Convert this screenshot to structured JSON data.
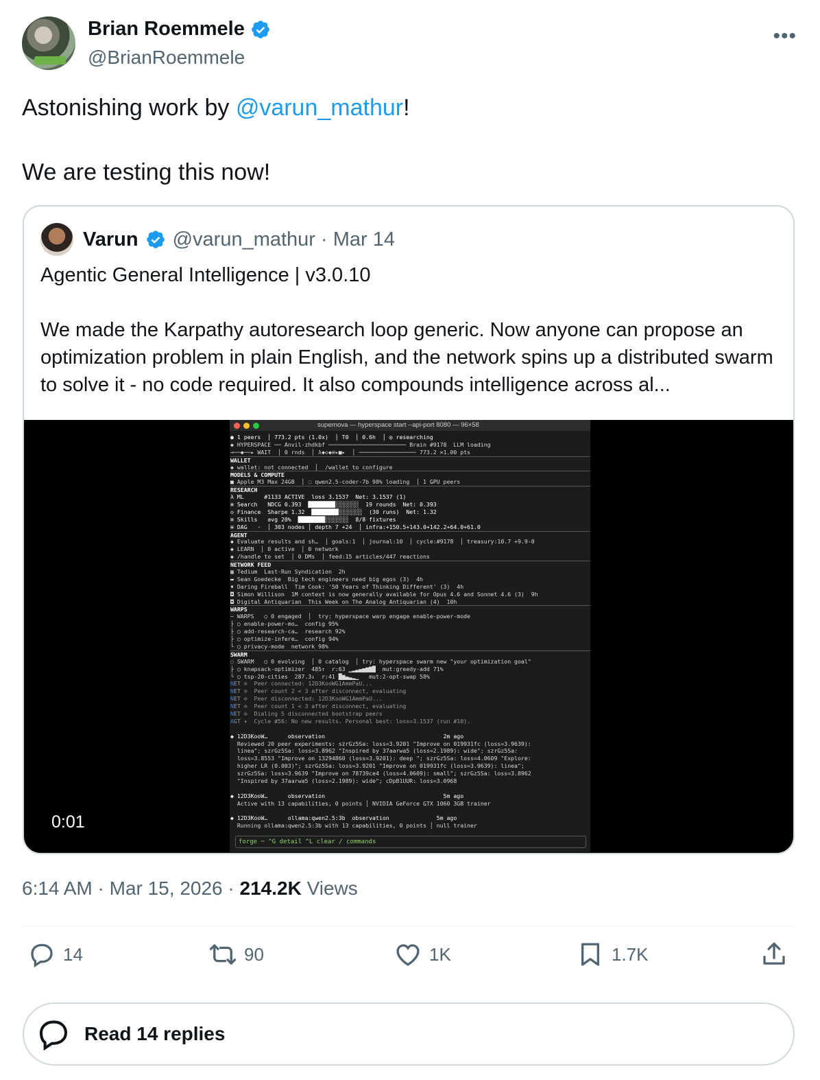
{
  "author": {
    "display_name": "Brian Roemmele",
    "handle": "@BrianRoemmele"
  },
  "tweet": {
    "text_before_mention": "Astonishing work by ",
    "mention": "@varun_mathur",
    "text_after_mention": "!",
    "second_line": "We are testing this now!"
  },
  "quote": {
    "display_name": "Varun",
    "handle_date": "@varun_mathur · Mar 14",
    "title": "Agentic General Intelligence | v3.0.10",
    "body": "We made the Karpathy autoresearch loop generic. Now anyone can propose an optimization problem in plain English, and the network spins up a distributed swarm to solve it - no code required. It also compounds intelligence across al...",
    "video_timecode": "0:01",
    "terminal": {
      "title": "supernova — hyperspace start --api-port 8080 — 96×58",
      "lines": [
        "● 1 peers  │ 773.2 pts (1.0x)  │ T0  │ 0.6h  │ ◎ researching",
        "◆ HYPERSPACE ── Anvil-zhdkbf ─────────────────────── Brain #9178  LLM loading",
        "⊸──◆──▸ WAIT  │ 0 rnds  │ λ◆◇◆≡▸■▸  │ ───────────────── 773.2 ×1.00 pts",
        "WALLET",
        "◆ wallet: not connected  │  /wallet to configure",
        "MODELS & COMPUTE",
        "■ Apple M3 Max 24GB  │ ◌ qwen2.5-coder-7b 98% loading  │ 1 GPU peers",
        "RESEARCH",
        "λ ML      #1133 ACTIVE  loss 3.1537  Net: 3.1537 (1)",
        "≡ Search   NDCG 0.393  ████████░░░░░░░  19 rounds  Net: 0.393",
        "◇ Finance  Sharpe 1.32  ████████░░░░░░░  (30 runs)  Net: 1.32",
        "≡ Skills   avg 20%  ████████░░░░░░░  8/8 fixtures",
        "≡ DAG   ·  │ 303 nodes │ depth 7 +24  │ infra:+150.5+143.0+142.2+64.0+61.0",
        "AGENT",
        "◆ Evaluate results and sh…  │ goals:1  │ journal:10  │ cycle:#9178  │ treasury:10.7 +9.9-0",
        "◆ LEARN  │ 0 active  │ 0 network",
        "◆ /handle to set  │ 0 DMs  │ feed:15 articles/447 reactions",
        "NETWORK FEED",
        "▦ Tedium  Last-Run Syndication  2h",
        "▬ Sean Goedecke  Big tech engineers need big egos (3)  4h",
        "♦ Daring Fireball  Tim Cook: '50 Years of Thinking Different' (3)  4h",
        "◘ Simon Willison  1M context is now generally available for Opus 4.6 and Sonnet 4.6 (3)  9h",
        "◘ Digital Antiquarian  This Week on The Analog Antiquarian (4)  10h",
        "WARPS",
        "~ WARPS   ○ 0 engaged  │  try: hyperspace warp engage enable-power-mode",
        "├ ○ enable-power-mo…  config 95%",
        "├ ○ add-research-ca…  research 92%",
        "├ ○ optimize-infere…  config 94%",
        "└ ○ privacy-mode  network 98%",
        "SWARM",
        "◌ SWARM   ○ 0 evolving  │ 0 catalog  │ try: hyperspace swarm new \"your optimization goal\"",
        "├ ○ knapsack-optimizer  485↑  r:63 ▁▂▃▄▅▆▇█  mut:greedy-add 71%",
        "└ ○ tsp-20-cities  287.3↓  r:41 █▆▄▃▂▁   mut:2-opt-swap 58%",
        "NET ⊙  Peer connected: 12D3KooWG1AmmPaU...",
        "NET ⊙  Peer count 2 < 3 after disconnect, evaluating",
        "NET ⊙  Peer disconnected: 12D3KooWG1AmmPaU...",
        "NET ⊙  Peer count 1 < 3 after disconnect, evaluating",
        "NET ⊙  Dialing 5 disconnected bootstrap peers",
        "AGT ✈  Cycle #56: No new results. Personal best: loss=3.1537 (run #10).",
        "",
        "◆ 12D3KooW…      observation                                   2m ago",
        "  Reviewed 20 peer experiments: szrGz5Sa: loss=3.9201 \"Improve on 019931fc (loss=3.9639):",
        "  linea\"; szrGz5Sa: loss=3.8962 \"Inspired by 37aarwa5 (loss=2.1989): wide\"; szrGz5Sa:",
        "  loss=3.8553 \"Improve on 13294860 (loss=3.9201): deep \"; szrGz5Sa: loss=4.0609 \"Explore:",
        "  higher LR (0.003)\"; szrGz5Sa: loss=3.9201 \"Improve on 019931fc (loss=3.9639): linea\";",
        "  szrGz5Sa: loss=3.9639 \"Improve on 78739ce4 (loss=4.0609): small\"; szrGz5Sa: loss=3.8962",
        "  \"Inspired by 37aarwa5 (loss=2.1989): wide\"; cDpB1UUR: loss=3.0968",
        "",
        "◆ 12D3KooW…      observation                                   5m ago",
        "  Active with 13 capabilities, 0 points │ NVIDIA GeForce GTX 1060 3GB trainer",
        "",
        "◆ 12D3KooW…      ollama:qwen2.5:3b  observation              5m ago",
        "  Running ollama:qwen2.5:3b with 13 capabilities, 0 points │ null trainer"
      ],
      "prompt": "forge ─ ^G detail  ^L clear  / commands"
    }
  },
  "meta": {
    "time_date": "6:14 AM · Mar 15, 2026 · ",
    "views_count": "214.2K",
    "views_label": " Views"
  },
  "actions": {
    "replies": "14",
    "reposts": "90",
    "likes": "1K",
    "bookmarks": "1.7K"
  },
  "read_replies": "Read 14 replies",
  "colors": {
    "link": "#1d9bf0",
    "muted": "#536471",
    "verified": "#1d9bf0"
  }
}
